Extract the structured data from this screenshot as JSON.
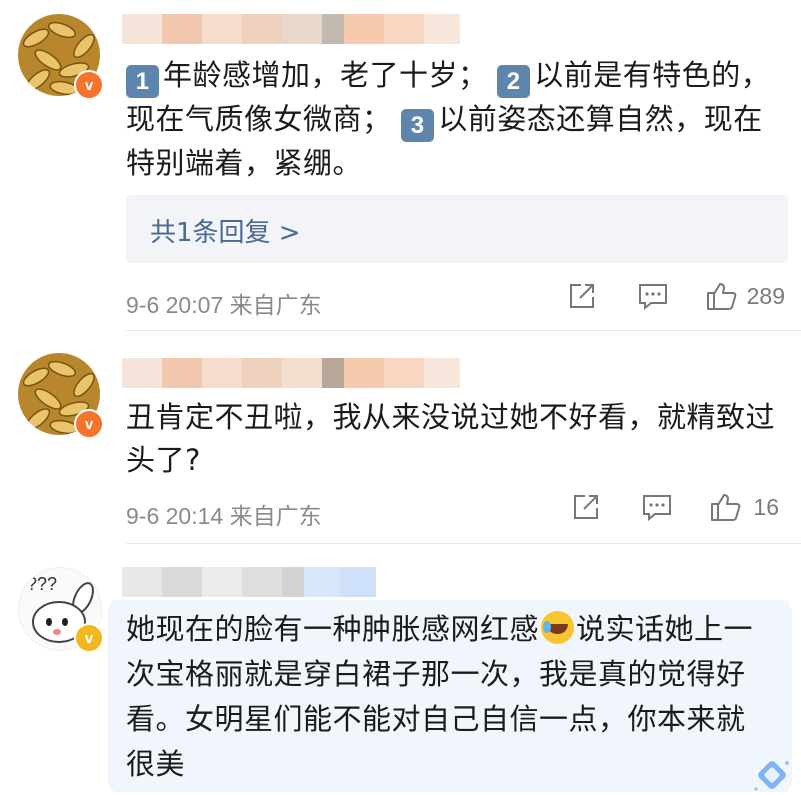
{
  "comments": [
    {
      "text_parts": {
        "n1": "1",
        "p1": "年龄感增加，老了十岁；",
        "n2": "2",
        "p2": "以前是有特色的，现在气质像女微商；",
        "n3": "3",
        "p3": "以前姿态还算自然，现在特别端着，紧绷。"
      },
      "reply_link": "共1条回复 >",
      "time": "9-6 20:07",
      "location": "来自广东",
      "likes": "289",
      "badge": "v"
    },
    {
      "text": "丑肯定不丑啦，我从来没说过她不好看，就精致过头了?",
      "time": "9-6 20:14",
      "location": "来自广东",
      "likes": "16",
      "badge": "v"
    },
    {
      "text_before_emoji": "她现在的脸有一种肿胀感网红感",
      "emoji": "laugh-cry-emoji",
      "text_after_emoji": "说实话她上一次宝格丽就是穿白裙子那一次，我是真的觉得好看。女明星们能不能对自己自信一点，你本来就很美",
      "badge": "v",
      "avatar_marks": "???"
    }
  ],
  "icons": {
    "share": "share-icon",
    "comment": "comment-icon",
    "like": "thumbs-up-icon",
    "sparkle": "diamond-sparkle-icon"
  },
  "colors": {
    "reply_link": "#496996",
    "number_badge": "#5e86ad",
    "verified_orange": "#f5732a",
    "verified_gold": "#f2b81f",
    "highlight_bg": "#f1f6fd"
  }
}
